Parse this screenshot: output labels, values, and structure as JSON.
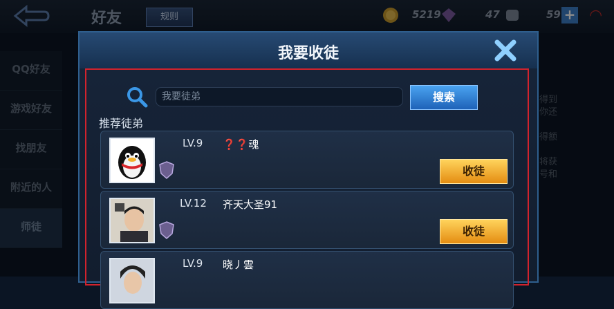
{
  "header": {
    "title": "好友",
    "rules_label": "规则",
    "resources": [
      {
        "icon": "coin-icon",
        "value": "5219"
      },
      {
        "icon": "diamond-icon",
        "value": "47"
      },
      {
        "icon": "voucher-icon",
        "value": "59"
      }
    ],
    "plus": "+"
  },
  "sidebar": {
    "items": [
      {
        "label": "QQ好友"
      },
      {
        "label": "游戏好友"
      },
      {
        "label": "找朋友"
      },
      {
        "label": "附近的人"
      },
      {
        "label": "师徒"
      }
    ]
  },
  "background_text": [
    "得到",
    "你还",
    "得额",
    "将获",
    "号和"
  ],
  "dialog": {
    "title": "我要收徒",
    "search": {
      "placeholder": "我要徒弟",
      "button_label": "搜索"
    },
    "section_label": "推荐徒弟",
    "candidates": [
      {
        "level": "LV.9",
        "name": "❓❓魂",
        "action": "收徒"
      },
      {
        "level": "LV.12",
        "name": "齐天大圣91",
        "action": "收徒"
      },
      {
        "level": "LV.9",
        "name": "晓丿雲"
      }
    ]
  },
  "colors": {
    "accent_blue": "#1e62b8",
    "recruit_gold": "#e48d12",
    "highlight_red": "#d2232d"
  }
}
